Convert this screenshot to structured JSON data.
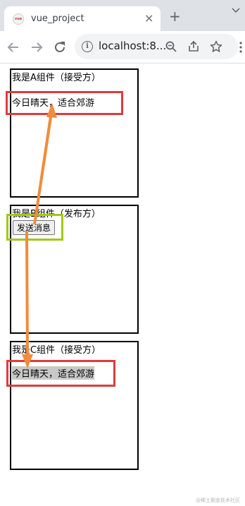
{
  "browser": {
    "tab_title": "vue_project",
    "favicon_text": "vue",
    "close_glyph": "×",
    "new_tab_glyph": "+",
    "url": "localhost:8..."
  },
  "page": {
    "component_a": {
      "heading": "我是A组件（接受方）",
      "message": "今日晴天，适合郊游"
    },
    "component_b": {
      "heading": "我是B组件（发布方）",
      "button_label": "发送消息"
    },
    "component_c": {
      "heading": "我是C组件（接受方）",
      "message": "今日晴天，适合郊游"
    }
  },
  "annotations": {
    "highlight_red": "#e03b3b",
    "highlight_green": "#a0c814",
    "arrow_color": "#f08c3c"
  },
  "watermark": "@稀土掘金技术社区",
  "icons": [
    "tab-favicon",
    "close-icon",
    "new-tab-icon",
    "tab-menu-icon",
    "back-icon",
    "forward-icon",
    "reload-icon",
    "info-icon",
    "zoom-icon",
    "share-icon",
    "bookmark-star-icon",
    "more-icon"
  ]
}
